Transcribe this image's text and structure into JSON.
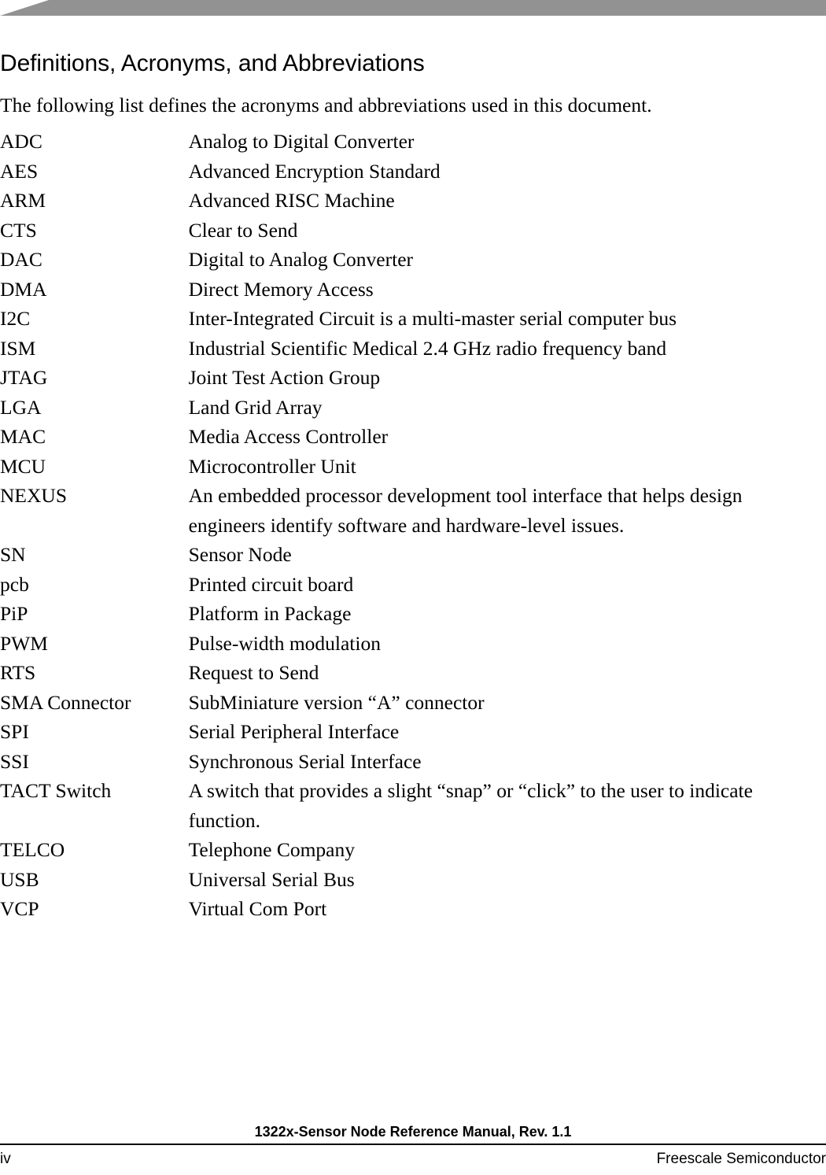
{
  "document": {
    "section_title": "Definitions, Acronyms, and Abbreviations",
    "intro": "The following list defines the acronyms and abbreviations used in this document.",
    "header_bar_color": "#929292"
  },
  "definitions": [
    {
      "term": "ADC",
      "definition": "Analog to Digital Converter"
    },
    {
      "term": "AES",
      "definition": "Advanced Encryption Standard"
    },
    {
      "term": "ARM",
      "definition": "Advanced RISC Machine"
    },
    {
      "term": "CTS",
      "definition": "Clear to Send"
    },
    {
      "term": "DAC",
      "definition": "Digital to Analog Converter"
    },
    {
      "term": "DMA",
      "definition": "Direct Memory Access"
    },
    {
      "term": "I2C",
      "definition": "Inter-Integrated Circuit is a multi-master serial computer bus"
    },
    {
      "term": "ISM",
      "definition": "Industrial Scientific Medical 2.4 GHz radio frequency band"
    },
    {
      "term": "JTAG",
      "definition": "Joint Test Action Group"
    },
    {
      "term": "LGA",
      "definition": "Land Grid Array"
    },
    {
      "term": "MAC",
      "definition": "Media Access Controller"
    },
    {
      "term": "MCU",
      "definition": "Microcontroller Unit"
    },
    {
      "term": "NEXUS",
      "definition": "An embedded processor development tool interface that helps design engineers identify software and hardware-level issues."
    },
    {
      "term": "SN",
      "definition": "Sensor Node"
    },
    {
      "term": "pcb",
      "definition": "Printed circuit board"
    },
    {
      "term": "PiP",
      "definition": "Platform in Package"
    },
    {
      "term": "PWM",
      "definition": "Pulse-width modulation"
    },
    {
      "term": "RTS",
      "definition": "Request to Send"
    },
    {
      "term": "SMA Connector",
      "definition": "SubMiniature version “A” connector"
    },
    {
      "term": "SPI",
      "definition": "Serial Peripheral Interface"
    },
    {
      "term": "SSI",
      "definition": "Synchronous Serial Interface"
    },
    {
      "term": "TACT Switch",
      "definition": "A switch that provides a slight “snap” or “click” to the user to indicate function."
    },
    {
      "term": "TELCO",
      "definition": "Telephone Company"
    },
    {
      "term": "USB",
      "definition": "Universal Serial Bus"
    },
    {
      "term": "VCP",
      "definition": "Virtual Com Port"
    }
  ],
  "footer": {
    "title": "1322x-Sensor Node Reference Manual, Rev. 1.1",
    "page_number": "iv",
    "company": "Freescale Semiconductor"
  }
}
